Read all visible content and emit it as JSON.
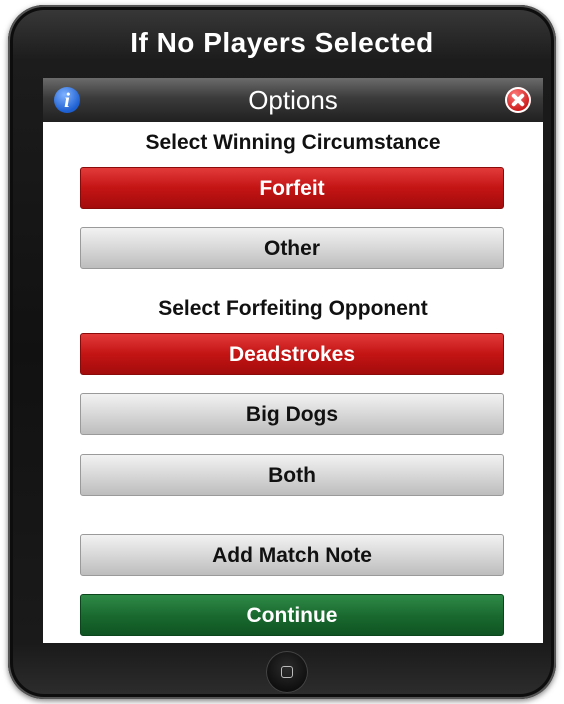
{
  "caption": "If No Players Selected",
  "dialog": {
    "title": "Options",
    "info_icon": "info-icon",
    "close_icon": "close-icon"
  },
  "sections": {
    "winning_heading": "Select Winning Circumstance",
    "forfeiting_heading": "Select Forfeiting Opponent"
  },
  "buttons": {
    "forfeit": "Forfeit",
    "other": "Other",
    "deadstrokes": "Deadstrokes",
    "big_dogs": "Big Dogs",
    "both": "Both",
    "add_match_note": "Add Match Note",
    "continue": "Continue"
  },
  "selected": {
    "winning_circumstance": "Forfeit",
    "forfeiting_opponent": "Deadstrokes"
  },
  "colors": {
    "selected": "#c41414",
    "unselected": "#d8d8d8",
    "continue": "#1a6b30"
  }
}
